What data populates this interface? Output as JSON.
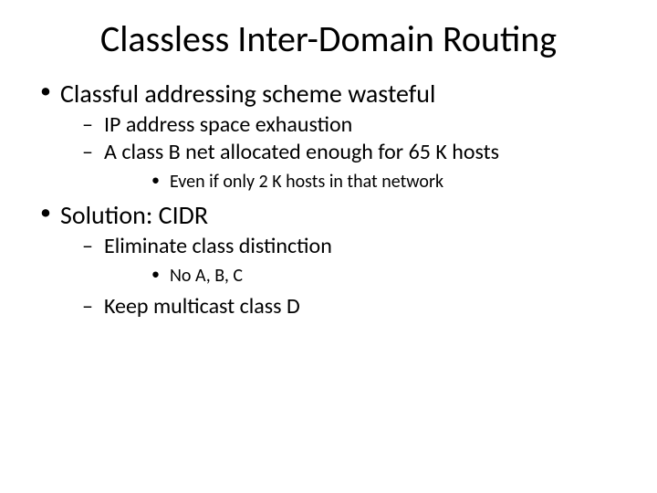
{
  "title": "Classless Inter-Domain Routing",
  "bullets": {
    "b1": "Classful addressing scheme wasteful",
    "b1_1": "IP address space exhaustion",
    "b1_2": "A class B net allocated enough for 65 K hosts",
    "b1_2_1": "Even if only 2 K hosts in that network",
    "b2": "Solution: CIDR",
    "b2_1": "Eliminate class distinction",
    "b2_1_1": "No A, B, C",
    "b2_2": "Keep multicast class D"
  }
}
